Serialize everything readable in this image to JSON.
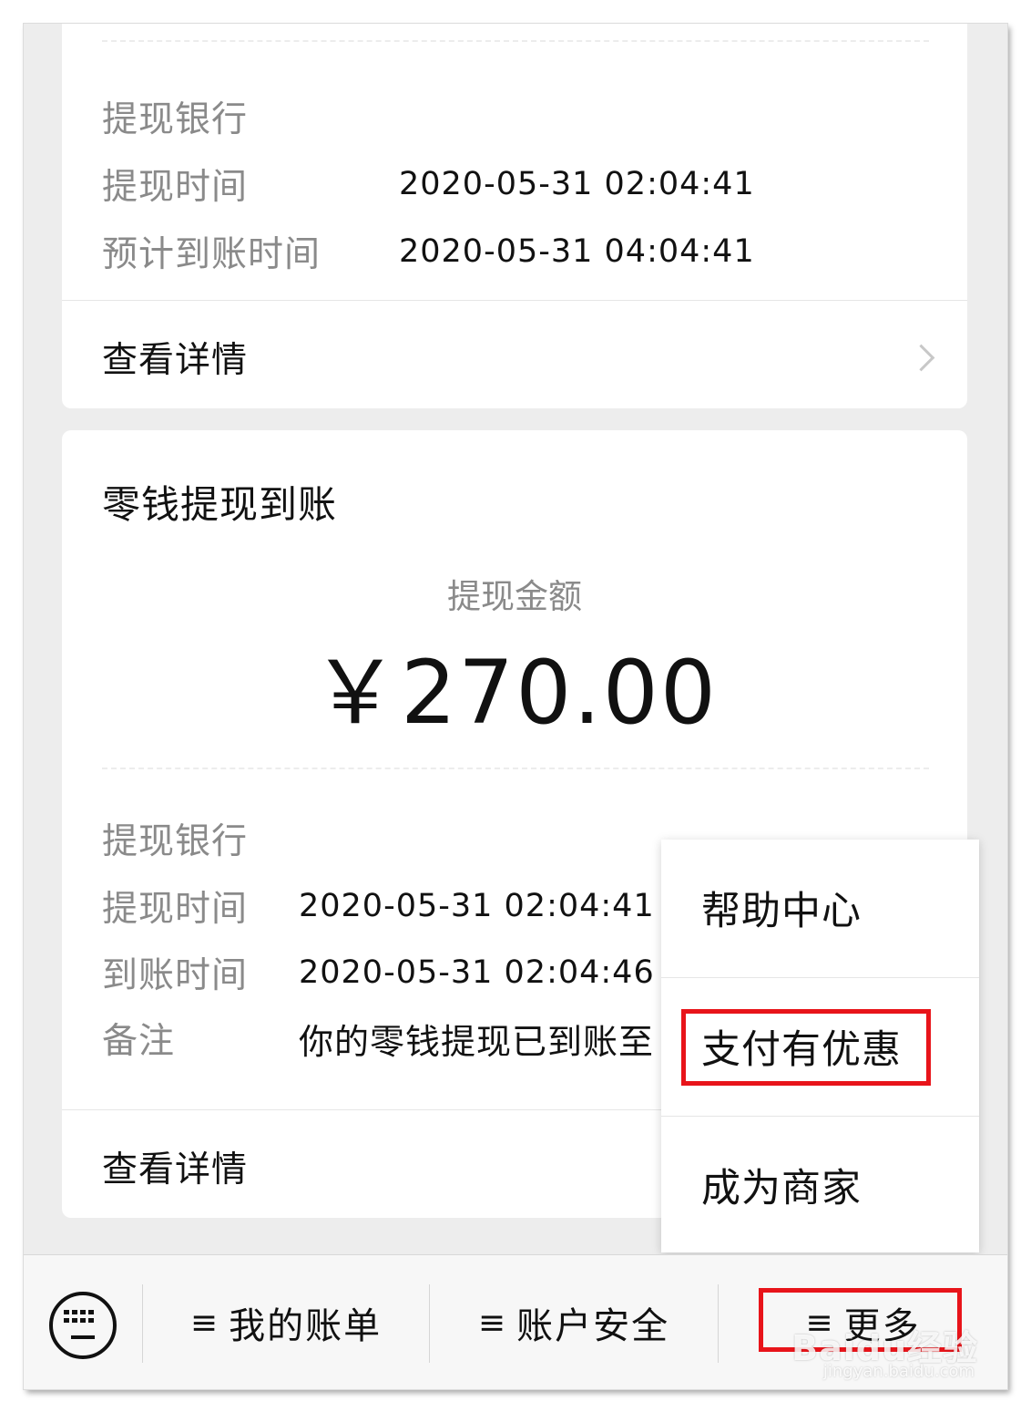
{
  "card1": {
    "rows": [
      {
        "label": "提现银行",
        "value": ""
      },
      {
        "label": "提现时间",
        "value": "2020-05-31 02:04:41"
      },
      {
        "label": "预计到账时间",
        "value": "2020-05-31 04:04:41"
      }
    ],
    "detail_label": "查看详情"
  },
  "card2": {
    "title": "零钱提现到账",
    "amount_label": "提现金额",
    "amount": "￥270.00",
    "rows": [
      {
        "label": "提现银行",
        "value": ""
      },
      {
        "label": "提现时间",
        "value": "2020-05-31 02:04:41"
      },
      {
        "label": "到账时间",
        "value": "2020-05-31 02:04:46"
      },
      {
        "label": "备注",
        "value": "你的零钱提现已到账至"
      }
    ],
    "detail_label": "查看详情"
  },
  "menu": {
    "items": [
      {
        "label": "帮助中心"
      },
      {
        "label": "支付有优惠"
      },
      {
        "label": "成为商家"
      }
    ]
  },
  "tabbar": {
    "tabs": [
      {
        "label": "我的账单"
      },
      {
        "label": "账户安全"
      },
      {
        "label": "更多"
      }
    ],
    "menu_glyph": "≡"
  },
  "watermark": {
    "text": "Baidu经验",
    "url_text": "jingyan.baidu.com"
  },
  "colors": {
    "highlight": "#e8141a",
    "background": "#ededed"
  }
}
